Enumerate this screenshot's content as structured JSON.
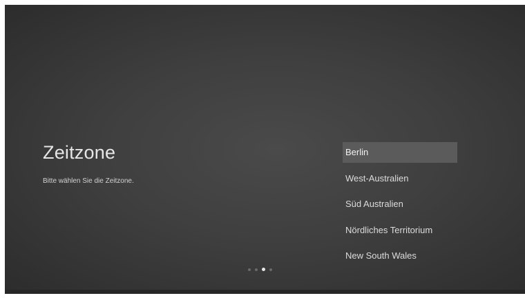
{
  "title": "Zeitzone",
  "subtitle": "Bitte wählen Sie die Zeitzone.",
  "timezones": [
    {
      "label": "Berlin",
      "selected": true
    },
    {
      "label": "West-Australien",
      "selected": false
    },
    {
      "label": "Süd Australien",
      "selected": false
    },
    {
      "label": "Nördliches Territorium",
      "selected": false
    },
    {
      "label": "New South Wales",
      "selected": false
    }
  ],
  "pagination": {
    "total": 4,
    "current": 3
  }
}
